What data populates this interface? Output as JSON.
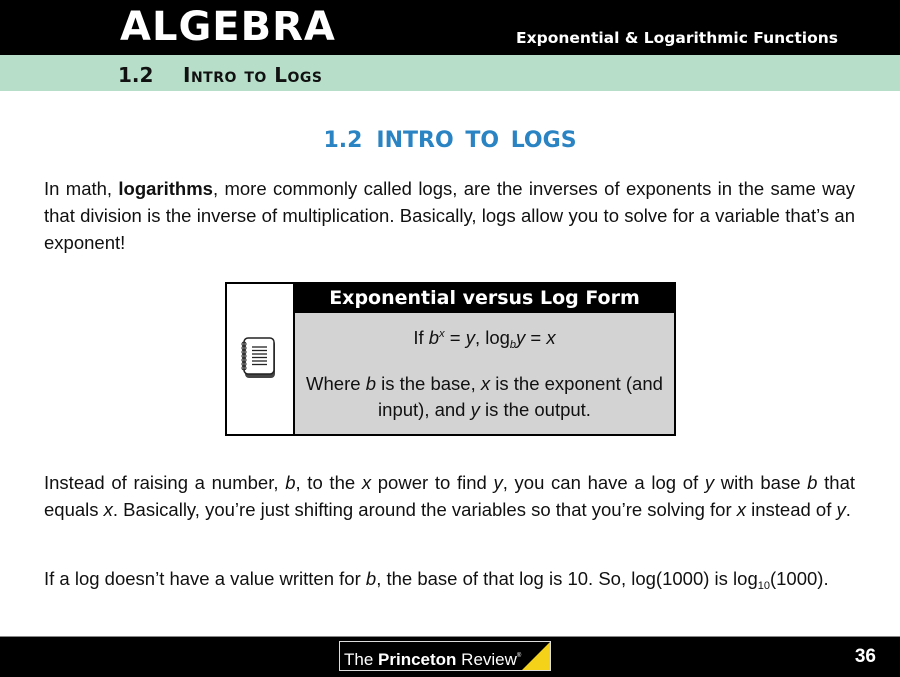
{
  "header": {
    "subject": "ALGEBRA",
    "chapter": "Exponential & Logarithmic Functions",
    "section_number": "1.2",
    "section_name": "Intro to Logs"
  },
  "heading": {
    "number": "1.2",
    "title": "INTRO TO LOGS",
    "color": "#2a84c3"
  },
  "paragraphs": {
    "p1": {
      "before": "In math, ",
      "bold": "logarithms",
      "after": ", more commonly called logs, are the inverses of exponents in the same way that division is the inverse of multiplication. Basically, logs allow you to solve for a variable that’s an exponent!"
    },
    "p2": {
      "t1": "Instead of raising a number, ",
      "b": "b",
      "t2": ", to the ",
      "x": "x",
      "t3": " power to find ",
      "y": "y",
      "t4": ", you can have a log of ",
      "y2": "y",
      "t5": " with base ",
      "b2": "b",
      "t6": " that equals ",
      "x2": "x",
      "t7": ". Basically, you’re just shifting around the variables so that you’re solving for ",
      "x3": "x",
      "t8": " instead of ",
      "y3": "y",
      "t9": "."
    },
    "p3": {
      "t1": "If a log doesn’t have a value written for ",
      "b": "b",
      "t2": ", the base of that log is 10. So, log(1000) is log",
      "sub": "10",
      "t3": "(1000)."
    }
  },
  "callout": {
    "icon": "notebook-icon",
    "title": "Exponential versus Log Form",
    "formula": {
      "if": "If ",
      "base": "b",
      "exp": "x",
      "eq1": " = ",
      "y": "y",
      "comma": ", log",
      "sub": "b",
      "y2": "y",
      "eq2": " = ",
      "x": "x"
    },
    "explain": {
      "t1": "Where ",
      "b": "b",
      "t2": " is the base, ",
      "x": "x",
      "t3": " is the exponent (and input), and ",
      "y": "y",
      "t4": " is the output."
    }
  },
  "footer": {
    "logo_the": "The ",
    "logo_princeton": "Princeton",
    "logo_review": " Review",
    "logo_reg": "®",
    "logo_accent": "#f5d21a",
    "page_number": "36"
  },
  "colors": {
    "section_bar": "#b6dec9",
    "callout_body": "#d3d3d3"
  }
}
